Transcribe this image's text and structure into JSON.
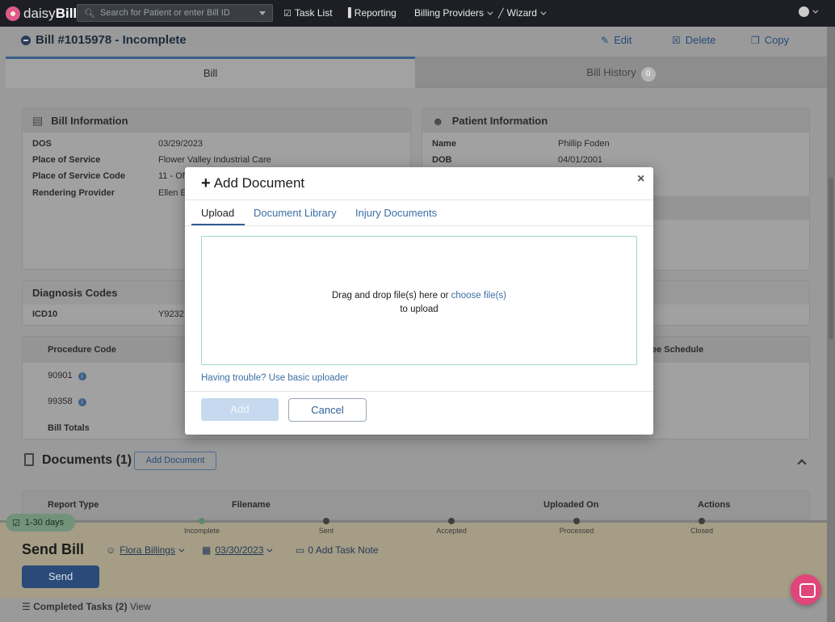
{
  "nav": {
    "logo_prefix": "daisy",
    "logo_suffix": "Bill",
    "search_placeholder": "Search for Patient or enter Bill ID",
    "items": [
      "Task List",
      "Reporting",
      "Billing Providers",
      "Wizard"
    ]
  },
  "header": {
    "title": "Bill #1015978 - Incomplete",
    "edit_label": "Edit",
    "delete_label": "Delete",
    "copy_label": "Copy"
  },
  "tabs": {
    "bill": "Bill",
    "history": "Bill History",
    "history_count": "0"
  },
  "bill_info": {
    "heading": "Bill Information",
    "rows": [
      {
        "label": "DOS",
        "value": "03/29/2023"
      },
      {
        "label": "Place of Service",
        "value": "Flower Valley Industrial Care"
      },
      {
        "label": "Place of Service Code",
        "value": "11 - Off"
      },
      {
        "label": "Rendering Provider",
        "value": "Ellen E"
      }
    ]
  },
  "patient_info": {
    "heading": "Patient Information",
    "rows": [
      {
        "label": "Name",
        "value": "Phillip Foden"
      },
      {
        "label": "DOB",
        "value": "04/01/2001"
      }
    ]
  },
  "diagnosis": {
    "heading": "Diagnosis Codes",
    "label": "ICD10",
    "value": "Y9232"
  },
  "procedures": {
    "col_code": "Procedure Code",
    "col_fee": "ee Schedule",
    "codes": [
      "90901",
      "99358"
    ],
    "totals_label": "Bill Totals"
  },
  "documents": {
    "heading": "Documents (1)",
    "add_label": "Add Document",
    "columns": [
      "Report Type",
      "Filename",
      "Uploaded On",
      "Actions"
    ]
  },
  "timeline": {
    "age_label": "1-30 days",
    "stages": [
      "Incomplete",
      "Sent",
      "Accepted",
      "Processed",
      "Closed"
    ]
  },
  "send": {
    "title": "Send Bill",
    "assignee": "Flora Billings",
    "date": "03/30/2023",
    "task_note": "0 Add Task Note",
    "button": "Send",
    "completed_label": "Completed Tasks (2)",
    "view_label": "View"
  },
  "modal": {
    "title": "Add Document",
    "tabs": [
      "Upload",
      "Document Library",
      "Injury Documents"
    ],
    "drop_text": "Drag and drop file(s) here or ",
    "drop_link": "choose file(s)",
    "drop_text2": "to upload",
    "trouble_text": "Having trouble? Use basic uploader",
    "add_button": "Add",
    "cancel_button": "Cancel"
  },
  "colors": {
    "nav_bg": "#1d1f24",
    "link_blue": "#3b6fa3",
    "dropzone_border": "#9ed9c6",
    "add_button_disabled": "#c6d9ef",
    "chat_pink": "#e0457b"
  }
}
